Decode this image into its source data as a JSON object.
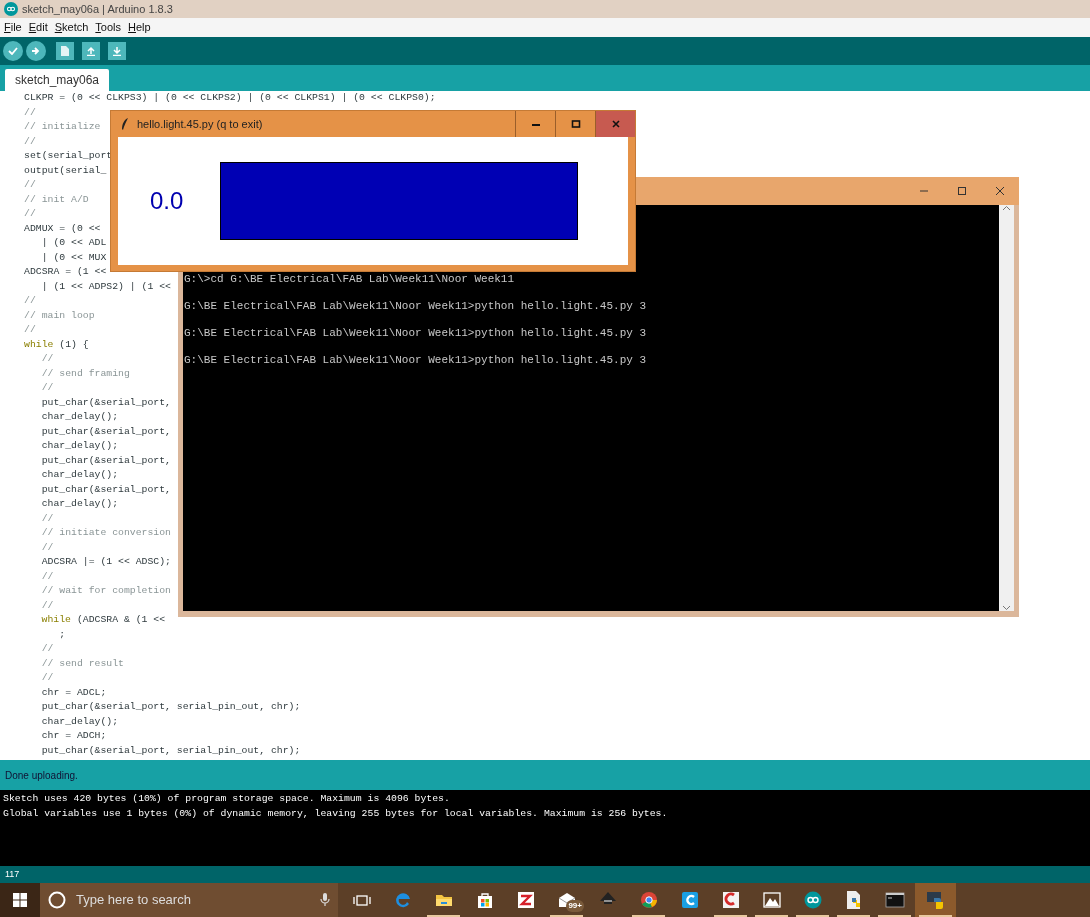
{
  "arduino": {
    "title": "sketch_may06a | Arduino 1.8.3",
    "menu": [
      "File",
      "Edit",
      "Sketch",
      "Tools",
      "Help"
    ],
    "tabs": [
      {
        "label": "sketch_may06a",
        "selected": true
      }
    ],
    "code": [
      {
        "kind": "code",
        "text": "CLKPR = (0 << CLKPS3) | (0 << CLKPS2) | (0 << CLKPS1) | (0 << CLKPS0);"
      },
      {
        "kind": "comment",
        "text": "//"
      },
      {
        "kind": "comment",
        "text": "// initialize"
      },
      {
        "kind": "comment",
        "text": "//"
      },
      {
        "kind": "code",
        "text": "set(serial_port"
      },
      {
        "kind": "code",
        "text": "output(serial_"
      },
      {
        "kind": "comment",
        "text": "//"
      },
      {
        "kind": "comment",
        "text": "// init A/D"
      },
      {
        "kind": "comment",
        "text": "//"
      },
      {
        "kind": "code",
        "text": "ADMUX = (0 <<"
      },
      {
        "kind": "code",
        "text": "   | (0 << ADL"
      },
      {
        "kind": "code",
        "text": "   | (0 << MUX"
      },
      {
        "kind": "code",
        "text": "ADCSRA = (1 <<"
      },
      {
        "kind": "code",
        "text": "   | (1 << ADPS2) | (1 <<"
      },
      {
        "kind": "comment",
        "text": "//"
      },
      {
        "kind": "comment",
        "text": "// main loop"
      },
      {
        "kind": "comment",
        "text": "//"
      },
      {
        "kind": "keyword",
        "indented": false,
        "keyword": "while",
        "text": " (1) {"
      },
      {
        "kind": "comment",
        "text": "   //"
      },
      {
        "kind": "comment",
        "text": "   // send framing"
      },
      {
        "kind": "comment",
        "text": "   //"
      },
      {
        "kind": "code",
        "text": "   put_char(&serial_port,"
      },
      {
        "kind": "code",
        "text": "   char_delay();"
      },
      {
        "kind": "code",
        "text": "   put_char(&serial_port,"
      },
      {
        "kind": "code",
        "text": "   char_delay();"
      },
      {
        "kind": "code",
        "text": "   put_char(&serial_port,"
      },
      {
        "kind": "code",
        "text": "   char_delay();"
      },
      {
        "kind": "code",
        "text": "   put_char(&serial_port,"
      },
      {
        "kind": "code",
        "text": "   char_delay();"
      },
      {
        "kind": "comment",
        "text": "   //"
      },
      {
        "kind": "comment",
        "text": "   // initiate conversion"
      },
      {
        "kind": "comment",
        "text": "   //"
      },
      {
        "kind": "code",
        "text": "   ADCSRA |= (1 << ADSC);"
      },
      {
        "kind": "comment",
        "text": "   //"
      },
      {
        "kind": "comment",
        "text": "   // wait for completion"
      },
      {
        "kind": "comment",
        "text": "   //"
      },
      {
        "kind": "keyword",
        "indented": true,
        "keyword": "while",
        "text": " (ADCSRA & (1 <<"
      },
      {
        "kind": "code",
        "text": "      ;"
      },
      {
        "kind": "comment",
        "text": "   //"
      },
      {
        "kind": "comment",
        "text": "   // send result"
      },
      {
        "kind": "comment",
        "text": "   //"
      },
      {
        "kind": "code",
        "text": "   chr = ADCL;"
      },
      {
        "kind": "code",
        "text": "   put_char(&serial_port, serial_pin_out, chr);"
      },
      {
        "kind": "code",
        "text": "   char_delay();"
      },
      {
        "kind": "code",
        "text": "   chr = ADCH;"
      },
      {
        "kind": "code",
        "text": "   put_char(&serial_port, serial_pin_out, chr);"
      }
    ],
    "status": "Done uploading.",
    "output": [
      "Sketch uses 420 bytes (10%) of program storage space. Maximum is 4096 bytes.",
      "Global variables use 1 bytes (0%) of dynamic memory, leaving 255 bytes for local variables. Maximum is 256 bytes."
    ],
    "line_number": "117"
  },
  "plot_window": {
    "title": "hello.light.45.py (q to exit)",
    "reading": "0.0"
  },
  "console_window": {
    "lines": [
      "G:\\>cd G:\\BE Electrical\\FAB Lab\\Week11\\Noor Week11",
      "G:\\BE Electrical\\FAB Lab\\Week11\\Noor Week11>python hello.light.45.py 3",
      "G:\\BE Electrical\\FAB Lab\\Week11\\Noor Week11>python hello.light.45.py 3",
      "G:\\BE Electrical\\FAB Lab\\Week11\\Noor Week11>python hello.light.45.py 3"
    ]
  },
  "taskbar": {
    "search_placeholder": "Type here to search",
    "apps": [
      {
        "kind": "taskview",
        "running": false,
        "active": false
      },
      {
        "kind": "edge",
        "running": false,
        "active": false
      },
      {
        "kind": "folder",
        "running": true,
        "active": false
      },
      {
        "kind": "store",
        "running": false,
        "active": false
      },
      {
        "kind": "redapp",
        "running": false,
        "active": false
      },
      {
        "kind": "mail",
        "badge": "99+",
        "running": true,
        "active": false
      },
      {
        "kind": "inkscape",
        "running": false,
        "active": false
      },
      {
        "kind": "chrome",
        "running": true,
        "active": false
      },
      {
        "kind": "cblue",
        "running": false,
        "active": false
      },
      {
        "kind": "cs",
        "running": true,
        "active": false
      },
      {
        "kind": "photos",
        "running": true,
        "active": false
      },
      {
        "kind": "arduino",
        "running": true,
        "active": false
      },
      {
        "kind": "pyfile",
        "running": true,
        "active": false
      },
      {
        "kind": "cmd",
        "running": true,
        "active": false
      },
      {
        "kind": "python",
        "running": true,
        "active": true
      }
    ]
  }
}
